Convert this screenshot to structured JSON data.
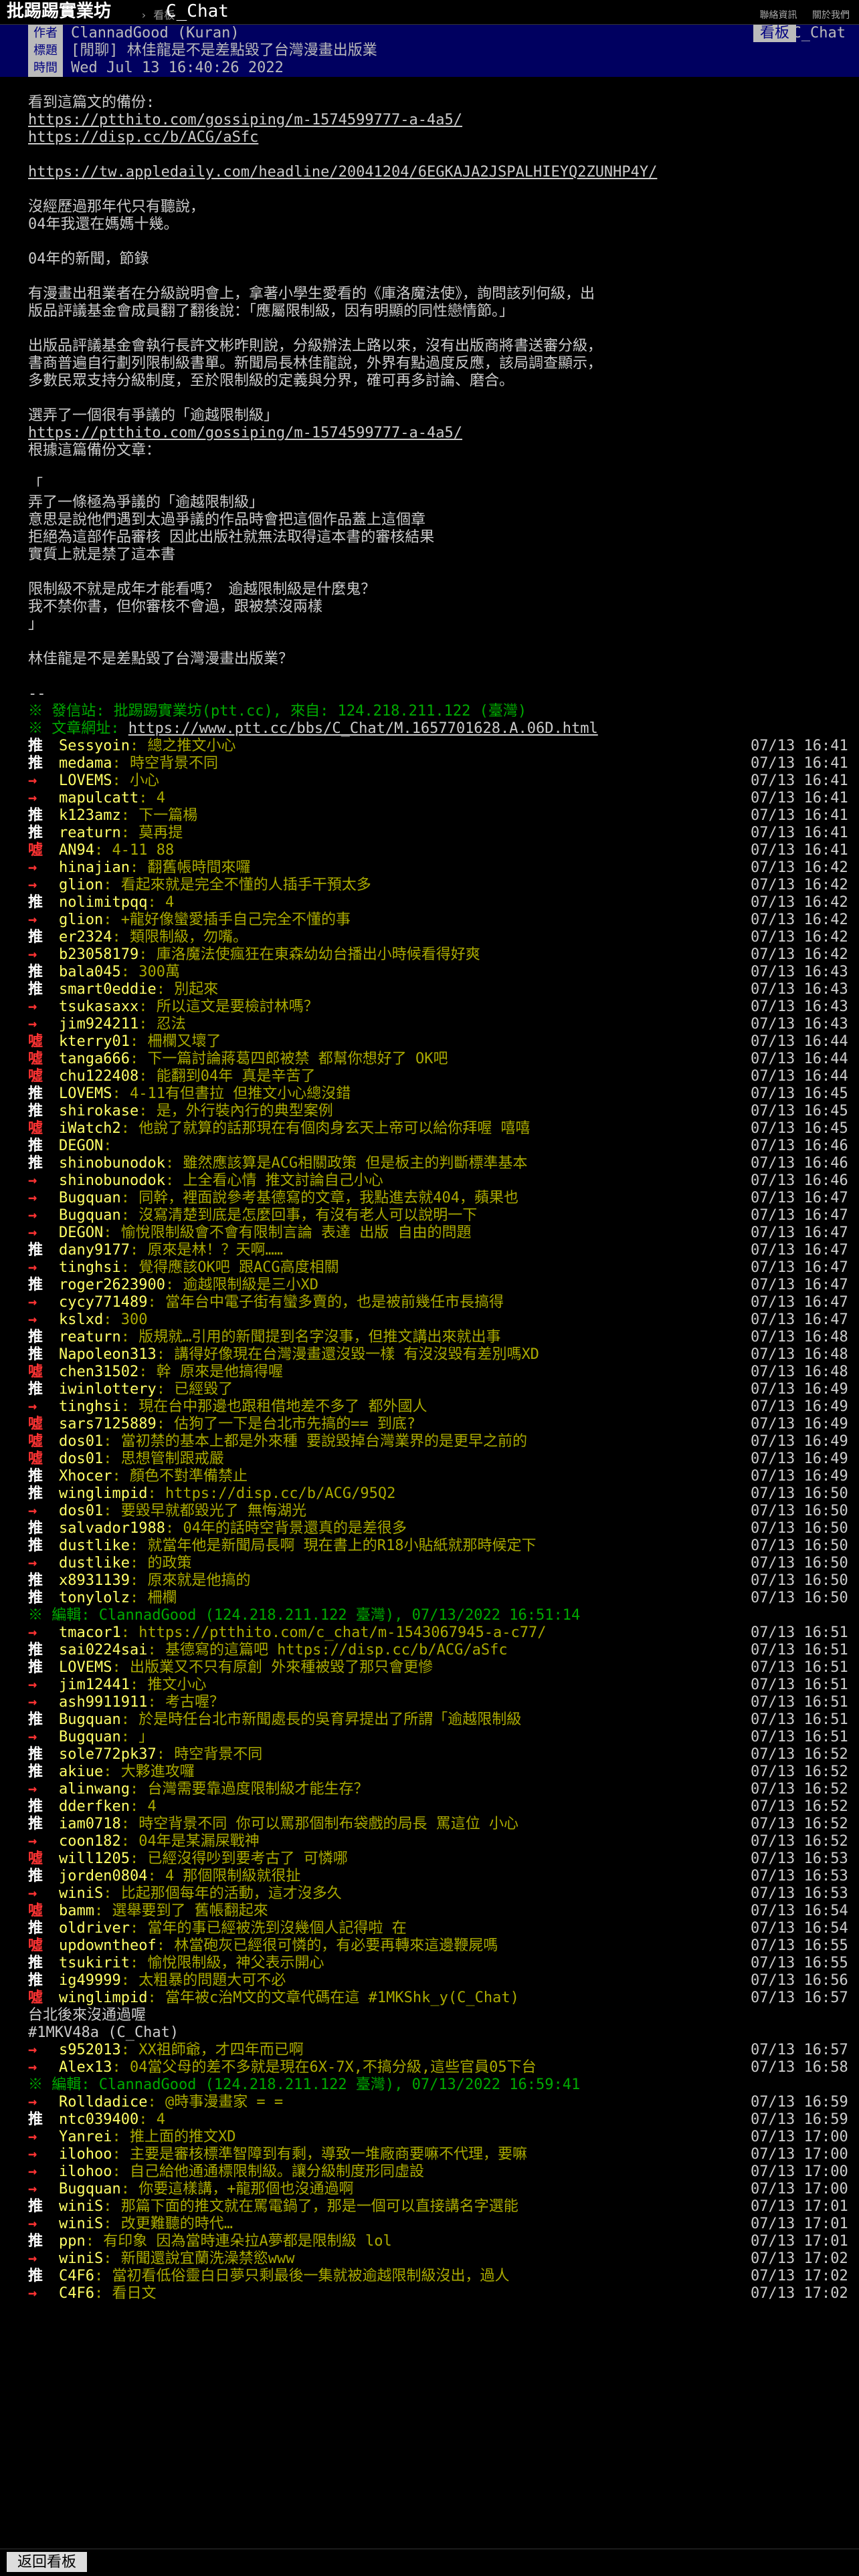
{
  "topbar": {
    "site": "批踢踢實業坊",
    "sep": "› 看板",
    "board": "C_Chat",
    "links": [
      "聯絡資訊",
      "關於我們"
    ]
  },
  "meta": {
    "author_tag": "作者",
    "author": "ClannadGood (Kuran)",
    "board_tag": "看板",
    "board": "C_Chat",
    "title_tag": "標題",
    "title": "[閒聊] 林佳龍是不是差點毀了台灣漫畫出版業",
    "time_tag": "時間",
    "time": "Wed Jul 13 16:40:26 2022"
  },
  "body": [
    "看到這篇文的備份:",
    "https://ptthito.com/gossiping/m-1574599777-a-4a5/",
    "https://disp.cc/b/ACG/aSfc",
    "",
    "https://tw.appledaily.com/headline/20041204/6EGKAJA2JSPALHIEYQ2ZUNHP4Y/",
    "",
    "沒經歷過那年代只有聽說，",
    "04年我還在媽媽十幾。",
    "",
    "04年的新聞，節錄",
    "",
    "有漫畫出租業者在分級說明會上，拿著小學生愛看的《庫洛魔法使》，詢問該列何級，出",
    "版品評議基金會成員翻了翻後說：「應屬限制級，因有明顯的同性戀情節。」",
    "",
    "出版品評議基金會執行長許文彬昨則說，分級辦法上路以來，沒有出版商將書送審分級，",
    "書商普遍自行劃列限制級書單。新聞局長林佳龍說，外界有點過度反應，該局調查顯示，",
    "多數民眾支持分級制度，至於限制級的定義與分界，確可再多討論、磨合。",
    "",
    "選弄了一個很有爭議的「逾越限制級」",
    "https://ptthito.com/gossiping/m-1574599777-a-4a5/",
    "根據這篇備份文章：",
    "",
    "「",
    "弄了一條極為爭議的「逾越限制級」",
    "意思是說他們遇到太過爭議的作品時會把這個作品蓋上這個章",
    "拒絕為這部作品審核 因此出版社就無法取得這本書的審核結果",
    "實質上就是禁了這本書",
    "",
    "限制級不就是成年才能看嗎？ 逾越限制級是什麼鬼？",
    "我不禁你書，但你審核不會過，跟被禁沒兩樣",
    "」",
    "",
    "林佳龍是不是差點毀了台灣漫畫出版業？",
    "",
    "--"
  ],
  "sig": {
    "origin": "※ 發信站: 批踢踢實業坊(ptt.cc), 來自: 124.218.211.122 (臺灣)",
    "url_label": "※ 文章網址: ",
    "url": "https://www.ptt.cc/bbs/C_Chat/M.1657701628.A.06D.html"
  },
  "pushes_a": [
    {
      "t": "推",
      "u": "Sessyoin",
      "x": ": 總之推文小心",
      "d": "07/13 16:41"
    },
    {
      "t": "推",
      "u": "medama",
      "x": ": 時空背景不同",
      "d": "07/13 16:41"
    },
    {
      "t": "→",
      "u": "LOVEMS",
      "x": ": 小心",
      "d": "07/13 16:41"
    },
    {
      "t": "→",
      "u": "mapulcatt",
      "x": ": 4",
      "d": "07/13 16:41"
    },
    {
      "t": "推",
      "u": "k123amz",
      "x": ": 下一篇楊",
      "d": "07/13 16:41"
    },
    {
      "t": "推",
      "u": "reaturn",
      "x": ": 莫再提",
      "d": "07/13 16:41"
    },
    {
      "t": "噓",
      "u": "AN94",
      "x": ": 4-11 88",
      "d": "07/13 16:41"
    },
    {
      "t": "→",
      "u": "hinajian",
      "x": ": 翻舊帳時間來囉",
      "d": "07/13 16:42"
    },
    {
      "t": "→",
      "u": "glion",
      "x": ": 看起來就是完全不懂的人插手干預太多",
      "d": "07/13 16:42"
    },
    {
      "t": "推",
      "u": "nolimitpqq",
      "x": ": 4",
      "d": "07/13 16:42"
    },
    {
      "t": "→",
      "u": "glion",
      "x": ": +龍好像蠻愛插手自己完全不懂的事",
      "d": "07/13 16:42"
    },
    {
      "t": "推",
      "u": "er2324",
      "x": ": 類限制級，勿嘴。",
      "d": "07/13 16:42"
    },
    {
      "t": "→",
      "u": "b23058179",
      "x": ": 庫洛魔法使瘋狂在東森幼幼台播出小時候看得好爽",
      "d": "07/13 16:42"
    },
    {
      "t": "推",
      "u": "bala045",
      "x": ": 300萬",
      "d": "07/13 16:43"
    },
    {
      "t": "推",
      "u": "smart0eddie",
      "x": ": 別起來",
      "d": "07/13 16:43"
    },
    {
      "t": "→",
      "u": "tsukasaxx",
      "x": ": 所以這文是要檢討林嗎？",
      "d": "07/13 16:43"
    },
    {
      "t": "→",
      "u": "jim924211",
      "x": ": 忍法",
      "d": "07/13 16:43"
    },
    {
      "t": "噓",
      "u": "kterry01",
      "x": ": 柵欄又壞了",
      "d": "07/13 16:44"
    },
    {
      "t": "噓",
      "u": "tanga666",
      "x": ": 下一篇討論蔣葛四郎被禁 都幫你想好了 OK吧",
      "d": "07/13 16:44"
    },
    {
      "t": "噓",
      "u": "chu122408",
      "x": ": 能翻到04年 真是辛苦了",
      "d": "07/13 16:44"
    },
    {
      "t": "推",
      "u": "LOVEMS",
      "x": ": 4-11有但書拉 但推文小心總沒錯",
      "d": "07/13 16:45"
    },
    {
      "t": "推",
      "u": "shirokase",
      "x": ": 是，外行裝內行的典型案例",
      "d": "07/13 16:45"
    },
    {
      "t": "噓",
      "u": "iWatch2",
      "x": ": 他說了就算的話那現在有個肉身玄天上帝可以給你拜喔 嘻嘻",
      "d": "07/13 16:45"
    },
    {
      "t": "推",
      "u": "DEGON",
      "x": ":",
      "d": "07/13 16:46"
    },
    {
      "t": "推",
      "u": "shinobunodok",
      "x": ": 雖然應該算是ACG相關政策 但是板主的判斷標準基本",
      "d": "07/13 16:46"
    },
    {
      "t": "→",
      "u": "shinobunodok",
      "x": ": 上全看心情 推文討論自己小心",
      "d": "07/13 16:46"
    },
    {
      "t": "→",
      "u": "Bugquan",
      "x": ": 同幹，裡面說參考基德寫的文章，我點進去就404，蘋果也",
      "d": "07/13 16:47"
    },
    {
      "t": "→",
      "u": "Bugquan",
      "x": ": 沒寫清楚到底是怎麼回事，有沒有老人可以說明一下",
      "d": "07/13 16:47"
    },
    {
      "t": "→",
      "u": "DEGON",
      "x": ": 愉悅限制級會不會有限制言論 表達 出版 自由的問題",
      "d": "07/13 16:47"
    },
    {
      "t": "推",
      "u": "dany9177",
      "x": ": 原來是林！？天啊……",
      "d": "07/13 16:47"
    },
    {
      "t": "→",
      "u": "tinghsi",
      "x": ": 覺得應該OK吧 跟ACG高度相關",
      "d": "07/13 16:47"
    },
    {
      "t": "推",
      "u": "roger2623900",
      "x": ": 逾越限制級是三小XD",
      "d": "07/13 16:47"
    },
    {
      "t": "→",
      "u": "cycy771489",
      "x": ": 當年台中電子街有蠻多賣的，也是被前幾任市長搞得",
      "d": "07/13 16:47"
    },
    {
      "t": "→",
      "u": "kslxd",
      "x": ": 300",
      "d": "07/13 16:47"
    },
    {
      "t": "推",
      "u": "reaturn",
      "x": ": 版規就…引用的新聞提到名字沒事，但推文講出來就出事",
      "d": "07/13 16:48"
    },
    {
      "t": "推",
      "u": "Napoleon313",
      "x": ": 講得好像現在台灣漫畫還沒毀一樣 有沒沒毀有差別嗎XD",
      "d": "07/13 16:48"
    },
    {
      "t": "噓",
      "u": "chen31502",
      "x": ": 幹 原來是他搞得喔",
      "d": "07/13 16:48"
    },
    {
      "t": "推",
      "u": "iwinlottery",
      "x": ": 已經毀了",
      "d": "07/13 16:49"
    },
    {
      "t": "→",
      "u": "tinghsi",
      "x": ": 現在台中那邊也跟租借地差不多了 都外國人",
      "d": "07/13 16:49"
    },
    {
      "t": "噓",
      "u": "sars7125889",
      "x": ": 估狗了一下是台北市先搞的== 到底?",
      "d": "07/13 16:49"
    },
    {
      "t": "噓",
      "u": "dos01",
      "x": ": 當初禁的基本上都是外來種 要說毀掉台灣業界的是更早之前的",
      "d": "07/13 16:49"
    },
    {
      "t": "噓",
      "u": "dos01",
      "x": ": 思想管制跟戒嚴",
      "d": "07/13 16:49"
    },
    {
      "t": "推",
      "u": "Xhocer",
      "x": ": 顏色不對準備禁止",
      "d": "07/13 16:49"
    },
    {
      "t": "推",
      "u": "winglimpid",
      "x": ": https://disp.cc/b/ACG/95Q2",
      "d": "07/13 16:50"
    },
    {
      "t": "→",
      "u": "dos01",
      "x": ": 要毀早就都毀光了 無悔湖光",
      "d": "07/13 16:50"
    },
    {
      "t": "推",
      "u": "salvador1988",
      "x": ": 04年的話時空背景還真的是差很多",
      "d": "07/13 16:50"
    },
    {
      "t": "推",
      "u": "dustlike",
      "x": ": 就當年他是新聞局長啊 現在書上的R18小貼紙就那時候定下",
      "d": "07/13 16:50"
    },
    {
      "t": "→",
      "u": "dustlike",
      "x": ": 的政策",
      "d": "07/13 16:50"
    },
    {
      "t": "推",
      "u": "x8931139",
      "x": ": 原來就是他搞的",
      "d": "07/13 16:50"
    },
    {
      "t": "推",
      "u": "tonylolz",
      "x": ": 柵欄",
      "d": "07/13 16:50"
    }
  ],
  "edit1": "※ 編輯: ClannadGood (124.218.211.122 臺灣), 07/13/2022 16:51:14",
  "pushes_b": [
    {
      "t": "→",
      "u": "tmacor1",
      "x": ": https://ptthito.com/c_chat/m-1543067945-a-c77/",
      "d": "07/13 16:51"
    },
    {
      "t": "推",
      "u": "sai0224sai",
      "x": ": 基德寫的這篇吧 https://disp.cc/b/ACG/aSfc",
      "d": "07/13 16:51"
    },
    {
      "t": "推",
      "u": "LOVEMS",
      "x": ": 出版業又不只有原創 外來種被毀了那只會更慘",
      "d": "07/13 16:51"
    },
    {
      "t": "→",
      "u": "jim12441",
      "x": ": 推文小心",
      "d": "07/13 16:51"
    },
    {
      "t": "→",
      "u": "ash9911911",
      "x": ": 考古喔？",
      "d": "07/13 16:51"
    },
    {
      "t": "推",
      "u": "Bugquan",
      "x": ": 於是時任台北市新聞處長的吳育昇提出了所謂「逾越限制級",
      "d": "07/13 16:51"
    },
    {
      "t": "→",
      "u": "Bugquan",
      "x": ": 」",
      "d": "07/13 16:51"
    },
    {
      "t": "推",
      "u": "sole772pk37",
      "x": ": 時空背景不同",
      "d": "07/13 16:52"
    },
    {
      "t": "推",
      "u": "akiue",
      "x": ": 大夥進攻囉",
      "d": "07/13 16:52"
    },
    {
      "t": "→",
      "u": "alinwang",
      "x": ": 台灣需要靠過度限制級才能生存？",
      "d": "07/13 16:52"
    },
    {
      "t": "推",
      "u": "dderfken",
      "x": ": 4",
      "d": "07/13 16:52"
    },
    {
      "t": "推",
      "u": "iam0718",
      "x": ": 時空背景不同 你可以罵那個制布袋戲的局長 罵這位 小心",
      "d": "07/13 16:52"
    },
    {
      "t": "→",
      "u": "coon182",
      "x": ": 04年是某漏屎戰神",
      "d": "07/13 16:52"
    },
    {
      "t": "噓",
      "u": "will1205",
      "x": ": 已經沒得吵到要考古了 可憐哪",
      "d": "07/13 16:53"
    },
    {
      "t": "推",
      "u": "jorden0804",
      "x": ": 4 那個限制級就很扯",
      "d": "07/13 16:53"
    },
    {
      "t": "→",
      "u": "winiS",
      "x": ": 比起那個每年的活動，這才沒多久",
      "d": "07/13 16:53"
    },
    {
      "t": "噓",
      "u": "bamm",
      "x": ": 選舉要到了 舊帳翻起來",
      "d": "07/13 16:54"
    },
    {
      "t": "推",
      "u": "oldriver",
      "x": ": 當年的事已經被洗到沒幾個人記得啦 在",
      "d": "07/13 16:54"
    },
    {
      "t": "噓",
      "u": "updowntheof",
      "x": ": 林當砲灰已經很可憐的，有必要再轉來這邊鞭屍嗎",
      "d": "07/13 16:55"
    },
    {
      "t": "推",
      "u": "tsukirit",
      "x": ": 愉悅限制級，神父表示開心",
      "d": "07/13 16:55"
    },
    {
      "t": "推",
      "u": "ig49999",
      "x": ": 太粗暴的問題大可不必",
      "d": "07/13 16:56"
    },
    {
      "t": "噓",
      "u": "winglimpid",
      "x": ": 當年被c治M文的文章代碼在這 #1MKShk_y(C_Chat)",
      "d": "07/13 16:57"
    }
  ],
  "quote_lines": [
    "台北後來沒通過喔",
    "#1MKV48a (C_Chat)"
  ],
  "pushes_c": [
    {
      "t": "→",
      "u": "s952013",
      "x": ": XX祖師爺，才四年而已啊",
      "d": "07/13 16:57"
    },
    {
      "t": "→",
      "u": "Alex13",
      "x": ": 04當父母的差不多就是現在6X-7X,不搞分級,這些官員05下台",
      "d": "07/13 16:58"
    }
  ],
  "edit2": "※ 編輯: ClannadGood (124.218.211.122 臺灣), 07/13/2022 16:59:41",
  "pushes_d": [
    {
      "t": "→",
      "u": "Rolldadice",
      "x": ": @時事漫畫家 = =",
      "d": "07/13 16:59"
    },
    {
      "t": "推",
      "u": "ntc039400",
      "x": ": 4",
      "d": "07/13 16:59"
    },
    {
      "t": "→",
      "u": "Yanrei",
      "x": ": 推上面的推文XD",
      "d": "07/13 17:00"
    },
    {
      "t": "→",
      "u": "ilohoo",
      "x": ": 主要是審核標準智障到有剩，導致一堆廠商要嘛不代理，要嘛",
      "d": "07/13 17:00"
    },
    {
      "t": "→",
      "u": "ilohoo",
      "x": ": 自己給他通通標限制級。讓分級制度形同虛設",
      "d": "07/13 17:00"
    },
    {
      "t": "→",
      "u": "Bugquan",
      "x": ": 你要這樣講，+龍那個也沒通過啊",
      "d": "07/13 17:00"
    },
    {
      "t": "推",
      "u": "winiS",
      "x": ": 那篇下面的推文就在罵電鍋了，那是一個可以直接講名字選能",
      "d": "07/13 17:01"
    },
    {
      "t": "→",
      "u": "winiS",
      "x": ": 改更難聽的時代…",
      "d": "07/13 17:01"
    },
    {
      "t": "推",
      "u": "ppn",
      "x": ": 有印象 因為當時連朵拉A夢都是限制級 lol",
      "d": "07/13 17:01"
    },
    {
      "t": "→",
      "u": "winiS",
      "x": ": 新聞還說宜蘭洗澡禁慾www",
      "d": "07/13 17:02"
    },
    {
      "t": "推",
      "u": "C4F6",
      "x": ": 當初看低俗靈白日夢只剩最後一集就被逾越限制級沒出，過人",
      "d": "07/13 17:02"
    },
    {
      "t": "→",
      "u": "C4F6",
      "x": ": 看日文",
      "d": "07/13 17:02"
    }
  ],
  "footer": {
    "back": "返回看板"
  },
  "colors": {
    "push_user": "#ffff66",
    "push_text": "#aaaa00",
    "meta_bg": "#000060",
    "arrow": "#ff3333"
  }
}
